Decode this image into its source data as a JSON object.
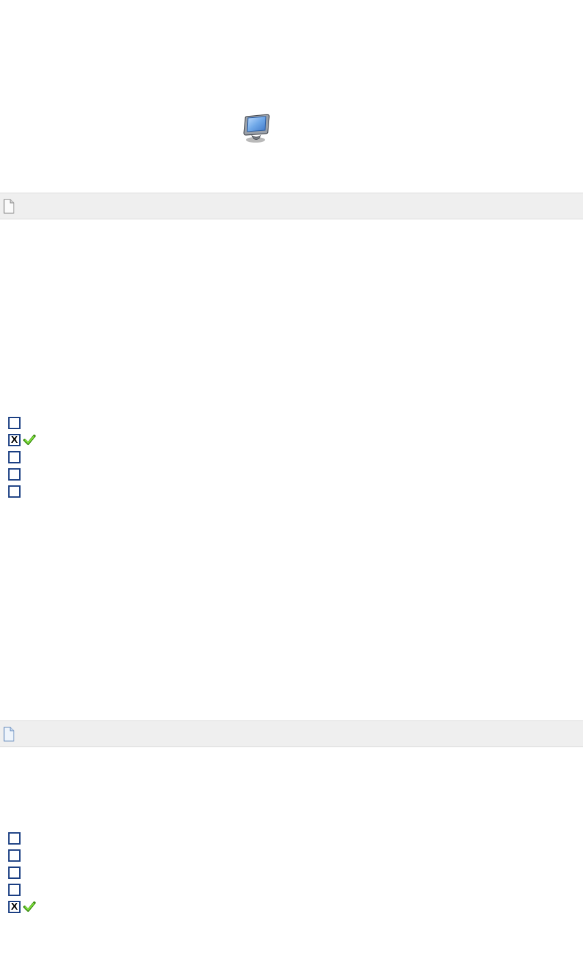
{
  "monitor": {
    "name": "computer-monitor-icon"
  },
  "section1": {
    "file_icon": "file-icon",
    "options": [
      {
        "checked": false,
        "correct": false
      },
      {
        "checked": true,
        "correct": true
      },
      {
        "checked": false,
        "correct": false
      },
      {
        "checked": false,
        "correct": false
      },
      {
        "checked": false,
        "correct": false
      }
    ]
  },
  "section2": {
    "file_icon": "template-file-icon",
    "options": [
      {
        "checked": false,
        "correct": false
      },
      {
        "checked": false,
        "correct": false
      },
      {
        "checked": false,
        "correct": false
      },
      {
        "checked": false,
        "correct": false
      },
      {
        "checked": true,
        "correct": true
      }
    ]
  },
  "colors": {
    "checkbox_border": "#1a3e82",
    "tick_fill": "#6fcf2f",
    "tick_stroke": "#3f8f16",
    "bar_bg": "#efefef"
  }
}
